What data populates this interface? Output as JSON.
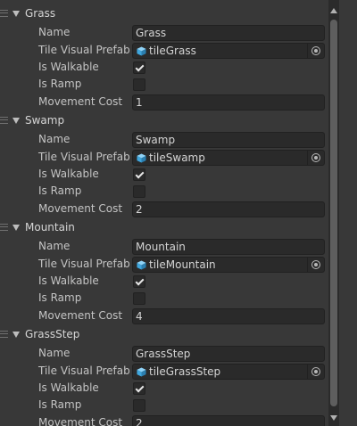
{
  "labels": {
    "name": "Name",
    "prefab": "Tile Visual Prefab",
    "walkable": "Is Walkable",
    "ramp": "Is Ramp",
    "cost": "Movement Cost"
  },
  "icons": {
    "foldout": "triangle-down-icon",
    "drag": "drag-handle-icon",
    "prefab": "prefab-cube-icon",
    "picker": "object-picker-icon"
  },
  "colors": {
    "background": "#383838",
    "field": "#2a2a2a",
    "prefab_icon": "#4fb4e8"
  },
  "tiles": [
    {
      "header": "Grass",
      "name": "Grass",
      "prefab": "tileGrass",
      "walkable": true,
      "ramp": false,
      "cost": "1"
    },
    {
      "header": "Swamp",
      "name": "Swamp",
      "prefab": "tileSwamp",
      "walkable": true,
      "ramp": false,
      "cost": "2"
    },
    {
      "header": "Mountain",
      "name": "Mountain",
      "prefab": "tileMountain",
      "walkable": true,
      "ramp": false,
      "cost": "4"
    },
    {
      "header": "GrassStep",
      "name": "GrassStep",
      "prefab": "tileGrassStep",
      "walkable": true,
      "ramp": false,
      "cost": "2"
    }
  ]
}
